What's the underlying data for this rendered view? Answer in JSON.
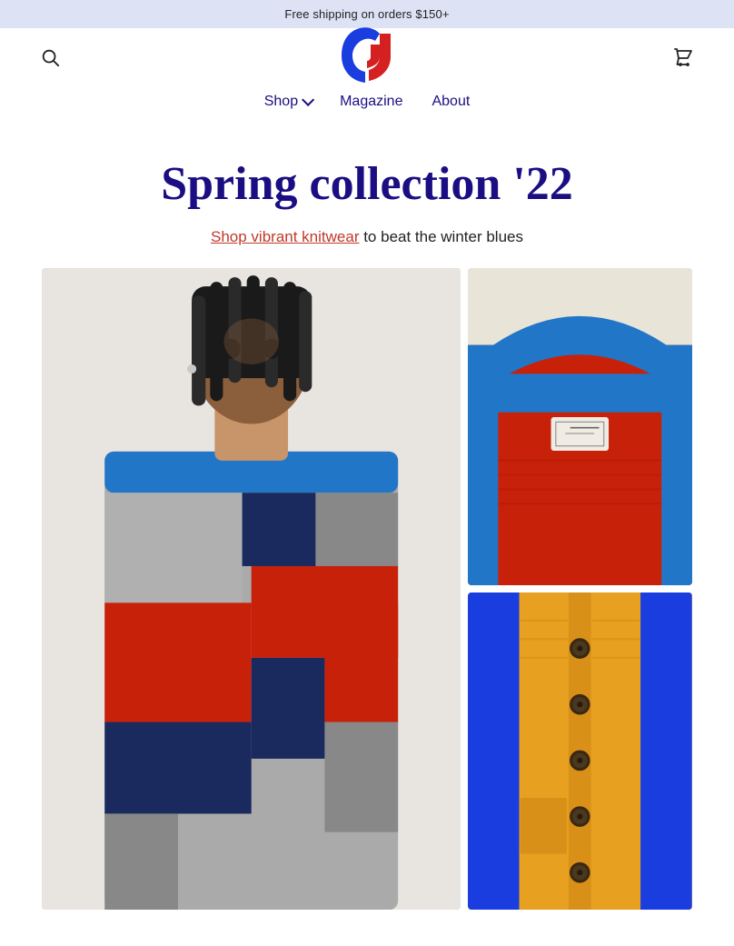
{
  "announcement": {
    "text": "Free shipping on orders $150+"
  },
  "header": {
    "search_label": "Search",
    "cart_label": "Cart",
    "logo_alt": "Brand Logo"
  },
  "nav": {
    "items": [
      {
        "label": "Shop",
        "has_dropdown": true
      },
      {
        "label": "Magazine",
        "has_dropdown": false
      },
      {
        "label": "About",
        "has_dropdown": false
      }
    ]
  },
  "hero": {
    "title": "Spring collection '22",
    "subtitle_link": "Shop vibrant knitwear",
    "subtitle_text": " to beat the winter blues"
  },
  "images": {
    "left_alt": "Model wearing colorblock knitwear",
    "right_top_alt": "Red and blue knit detail",
    "right_bottom_alt": "Blue and orange cardigan detail"
  }
}
